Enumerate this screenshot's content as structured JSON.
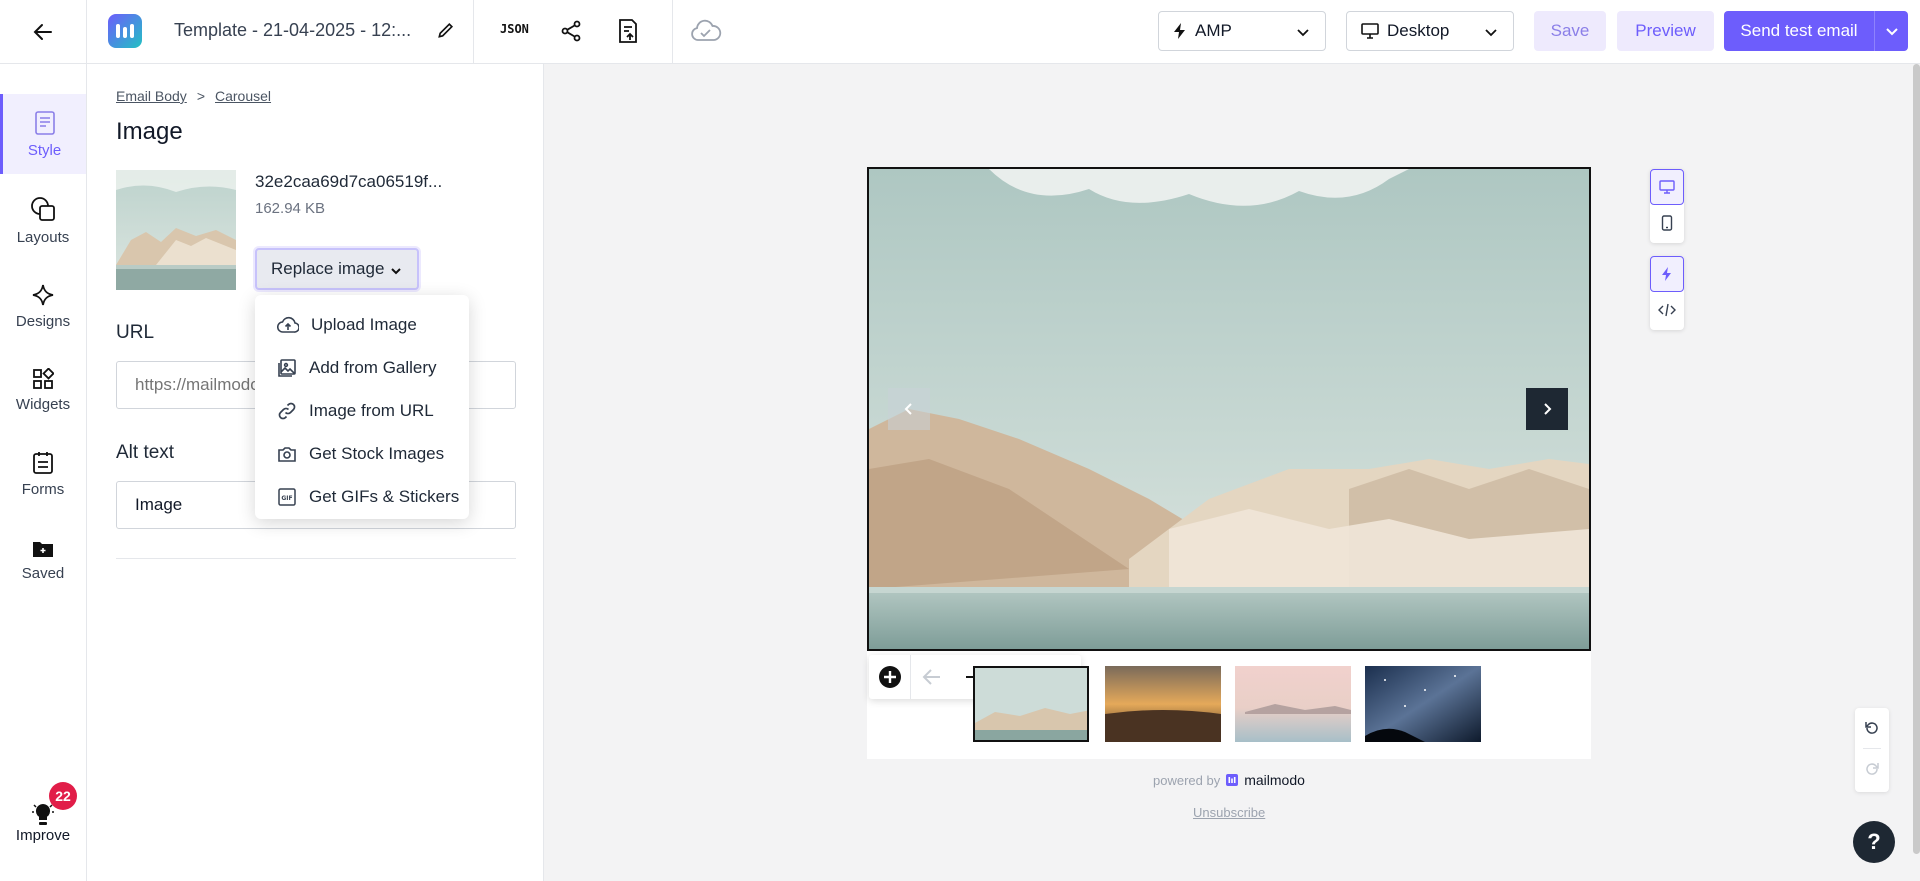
{
  "header": {
    "title": "Template - 21-04-2025 - 12:...",
    "json_label": "JSON",
    "format_select": {
      "value": "AMP",
      "icon": "lightning-icon"
    },
    "device_select": {
      "value": "Desktop",
      "icon": "monitor-icon"
    },
    "save_label": "Save",
    "preview_label": "Preview",
    "send_label": "Send test email"
  },
  "sidebar": {
    "items": [
      {
        "label": "Style",
        "icon": "style-icon",
        "active": true
      },
      {
        "label": "Layouts",
        "icon": "layouts-icon"
      },
      {
        "label": "Designs",
        "icon": "sparkle-icon"
      },
      {
        "label": "Widgets",
        "icon": "widgets-icon"
      },
      {
        "label": "Forms",
        "icon": "forms-icon"
      },
      {
        "label": "Saved",
        "icon": "folder-icon"
      }
    ],
    "improve": {
      "label": "Improve",
      "badge": "22"
    }
  },
  "panel": {
    "breadcrumb": [
      "Email Body",
      ">",
      "Carousel"
    ],
    "title": "Image",
    "file": {
      "name": "32e2caa69d7ca06519f...",
      "size": "162.94 KB"
    },
    "replace_label": "Replace image",
    "url_label": "URL",
    "url_placeholder": "https://mailmodo",
    "alt_label": "Alt text",
    "alt_value": "Image"
  },
  "replace_menu": [
    {
      "label": "Upload Image",
      "icon": "cloud-upload-icon"
    },
    {
      "label": "Add from Gallery",
      "icon": "gallery-icon"
    },
    {
      "label": "Image from URL",
      "icon": "link-icon"
    },
    {
      "label": "Get Stock Images",
      "icon": "camera-icon"
    },
    {
      "label": "Get GIFs & Stickers",
      "icon": "gif-icon"
    }
  ],
  "canvas": {
    "powered_by": "powered by",
    "brand": "mailmodo",
    "unsubscribe": "Unsubscribe"
  },
  "colors": {
    "accent": "#6d5dfc",
    "dark": "#1e2833",
    "badge": "#e11d48"
  }
}
